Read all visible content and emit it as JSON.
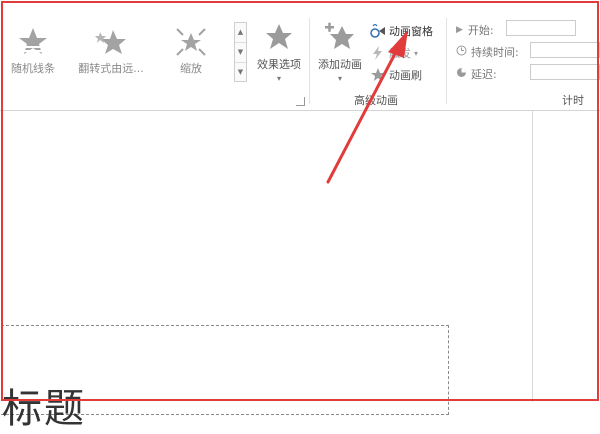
{
  "ribbon": {
    "gallery": [
      {
        "label": "随机线条",
        "icon": "random-bars-star-icon"
      },
      {
        "label": "翻转式由远...",
        "icon": "flip-star-icon"
      },
      {
        "label": "缩放",
        "icon": "zoom-star-icon"
      }
    ],
    "effect_options_label": "效果选项",
    "add_animation_label": "添加动画",
    "animation_pane_label": "动画窗格",
    "trigger_label": "触发",
    "painter_label": "动画刷",
    "advanced_group_label": "高级动画",
    "timing": {
      "start_label": "开始:",
      "duration_label": "持续时间:",
      "delay_label": "延迟:",
      "group_label": "计时"
    }
  },
  "slide": {
    "title_fragment": "标题"
  },
  "colors": {
    "annotation_red": "#e23b3b",
    "icon_gray": "#9b9b9b",
    "accent_blue": "#2f6fb3"
  }
}
